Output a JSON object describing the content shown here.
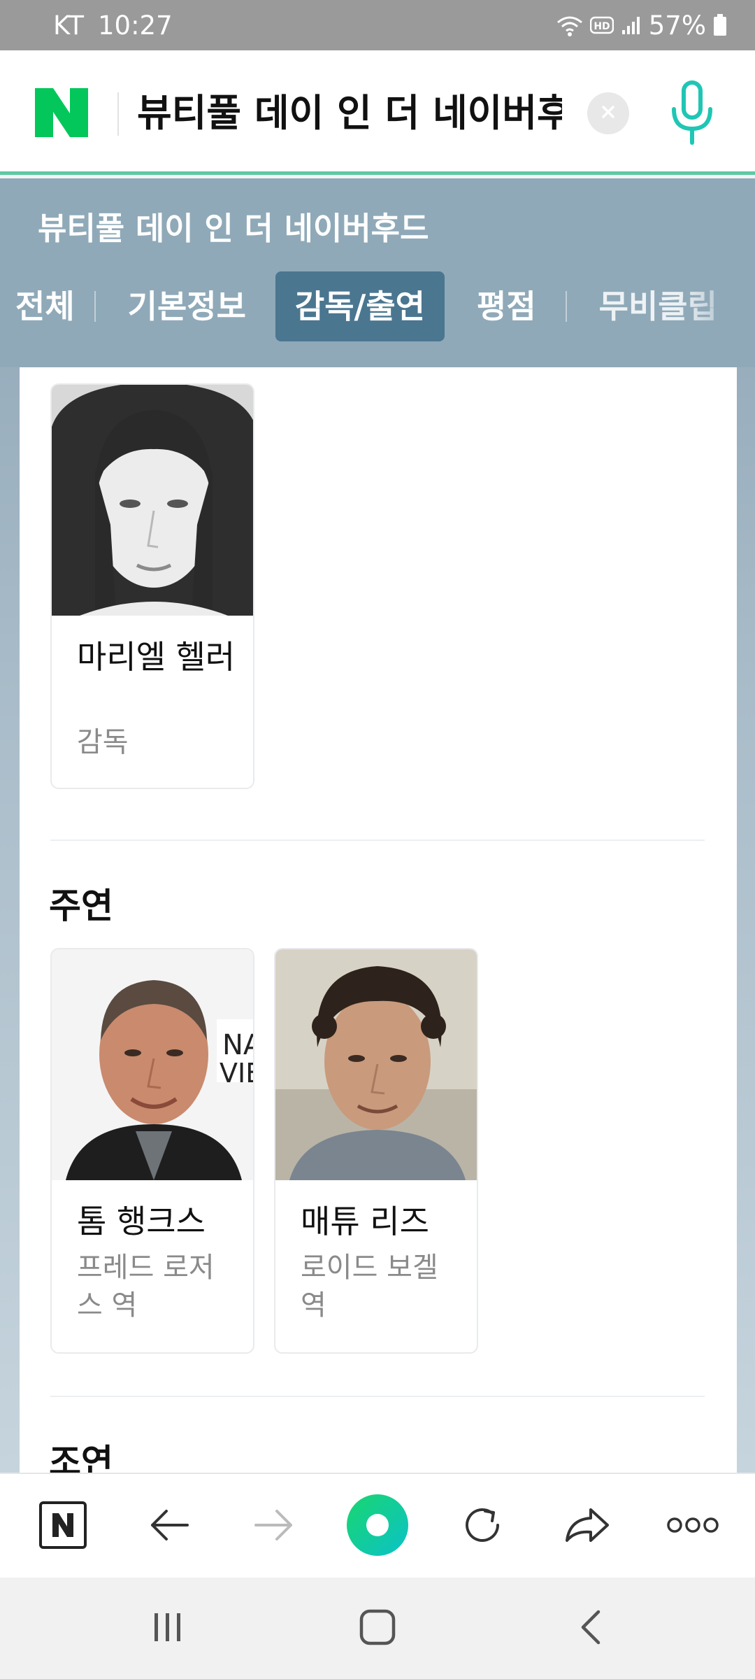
{
  "status_bar": {
    "carrier": "KT",
    "time": "10:27",
    "battery": "57%",
    "icons": [
      "wifi-icon",
      "hd-icon",
      "signal-icon",
      "battery-icon"
    ]
  },
  "search": {
    "query": "뷰티풀 데이 인 더 네이버후드",
    "icons": [
      "naver-logo",
      "clear-icon",
      "mic-icon"
    ]
  },
  "movie": {
    "title": "뷰티풀 데이 인 더 네이버후드"
  },
  "tabs": [
    {
      "label": "전체",
      "active": false
    },
    {
      "label": "기본정보",
      "active": false
    },
    {
      "label": "감독/출연",
      "active": true
    },
    {
      "label": "평점",
      "active": false
    },
    {
      "label": "무비클립",
      "active": false
    }
  ],
  "director": {
    "name": "마리엘 헬러",
    "role": "감독"
  },
  "main_cast": {
    "heading": "주연",
    "people": [
      {
        "name": "톰 행크스",
        "role": "프레드 로저스 역"
      },
      {
        "name": "매튜 리즈",
        "role": "로이드 보겔 역"
      }
    ]
  },
  "supporting_cast": {
    "heading": "조연"
  },
  "toolbar": {
    "items": [
      "naver-home-icon",
      "back-icon",
      "forward-icon",
      "green-dot-icon",
      "refresh-icon",
      "share-icon",
      "more-icon"
    ]
  },
  "colors": {
    "naver_green": "#03c75a",
    "tab_bar_bg": "#8fa9b8",
    "active_tab_bg": "#4a7690",
    "accent_line": "#5fc9a3"
  }
}
